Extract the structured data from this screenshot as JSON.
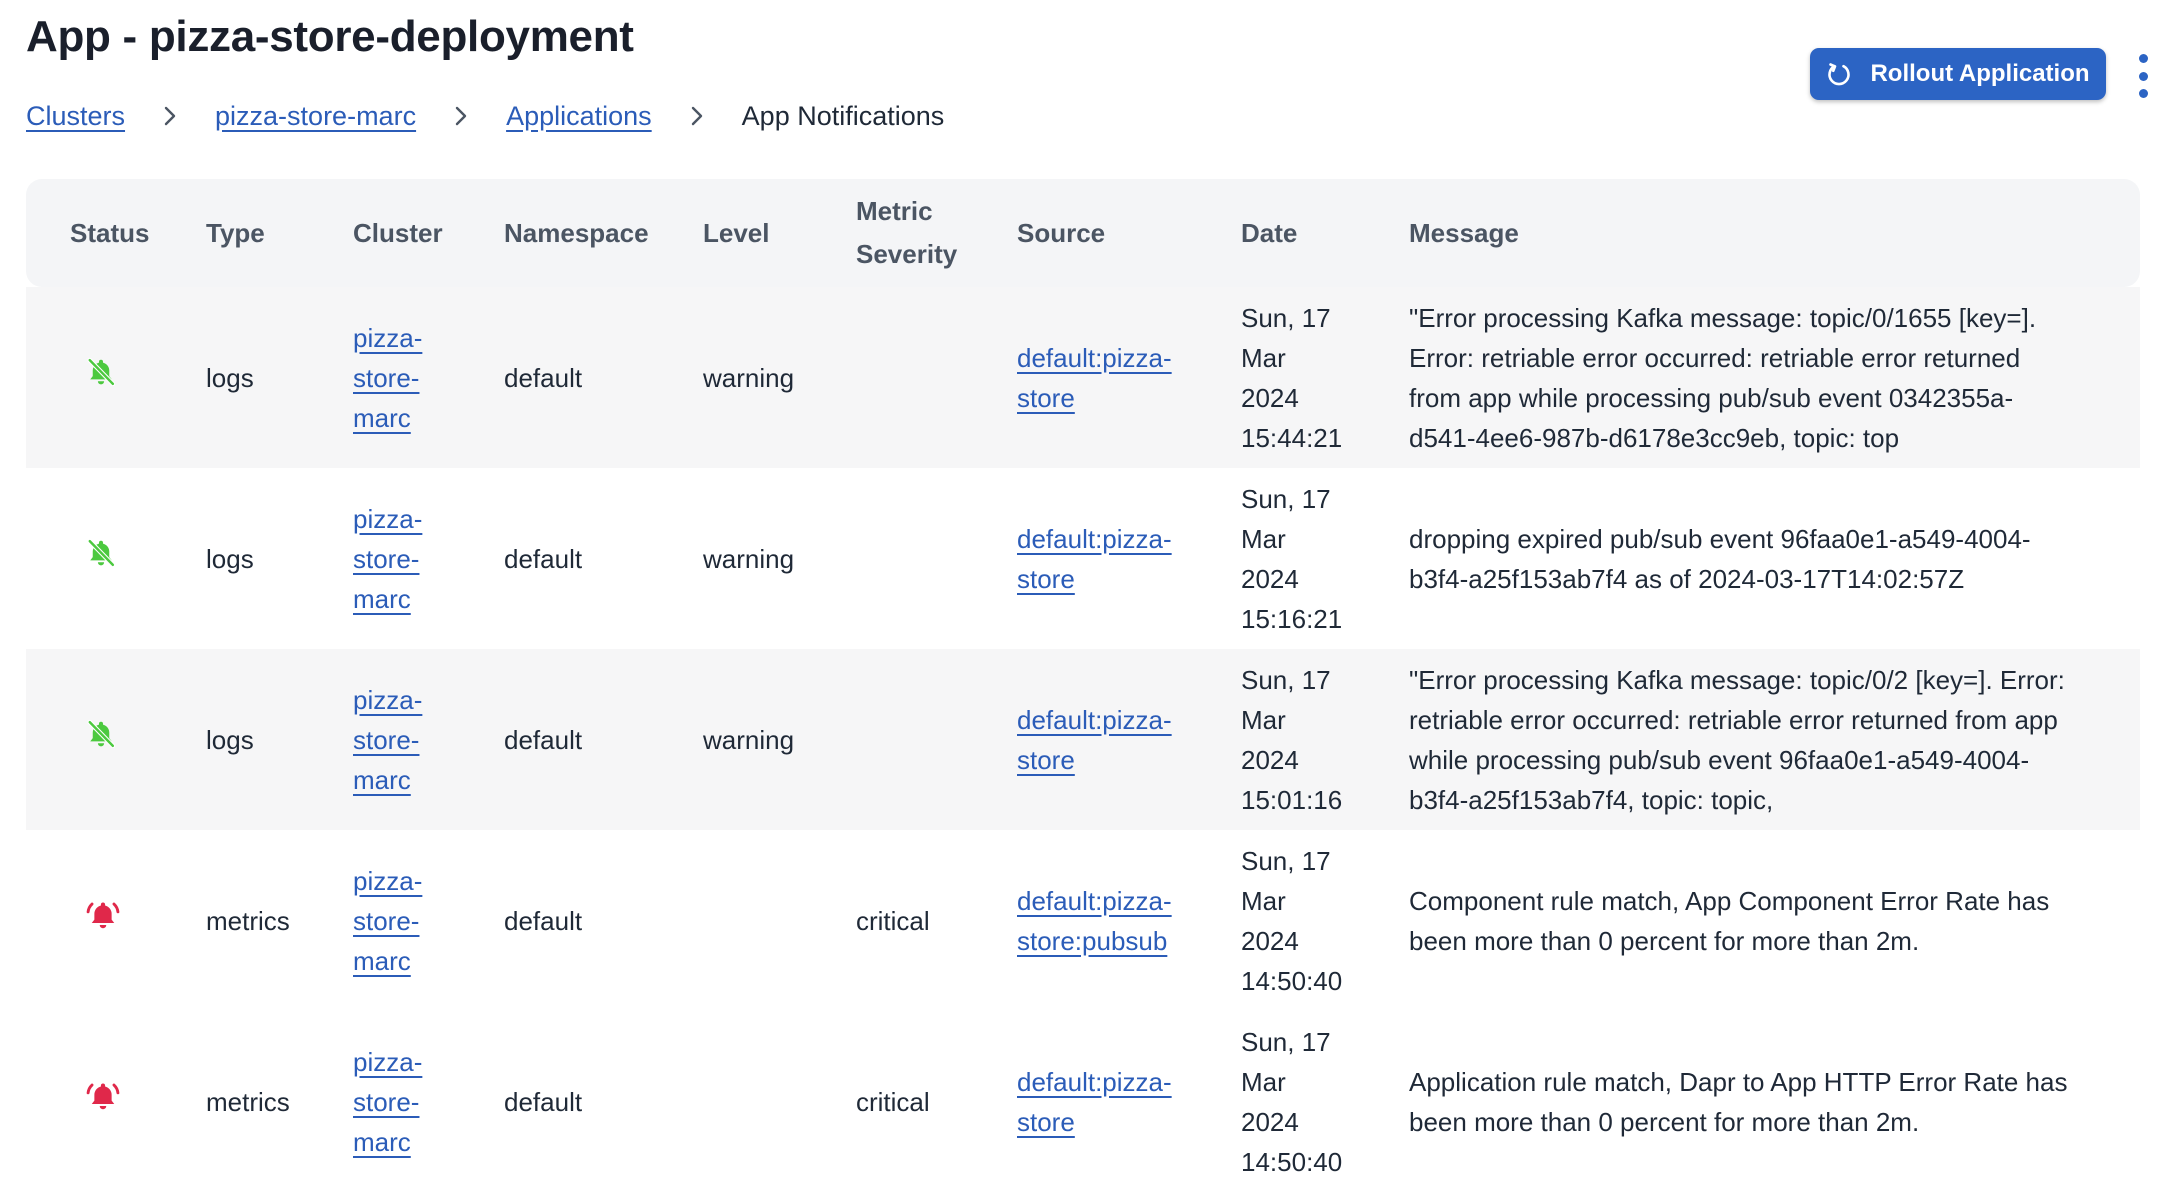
{
  "page": {
    "title": "App - pizza-store-deployment",
    "rollout_label": "Rollout Application"
  },
  "breadcrumb": {
    "items": [
      "Clusters",
      "pizza-store-marc",
      "Applications"
    ],
    "current": "App Notifications"
  },
  "table": {
    "headers": {
      "status": "Status",
      "type": "Type",
      "cluster": "Cluster",
      "namespace": "Namespace",
      "level": "Level",
      "metric_severity_1": "Metric",
      "metric_severity_2": "Severity",
      "source": "Source",
      "date": "Date",
      "message": "Message"
    },
    "rows": [
      {
        "status_icon": "bell-off-icon",
        "status_color": "#4cc93f",
        "type": "logs",
        "cluster": [
          "pizza-",
          "store-",
          "marc"
        ],
        "namespace": "default",
        "level": "warning",
        "metric_severity": "",
        "source": [
          "default:pizza-",
          "store"
        ],
        "date": [
          "Sun, 17",
          "Mar",
          "2024",
          "15:44:21"
        ],
        "message": [
          "\"Error processing Kafka message: topic/0/1655 [key=].",
          "Error: retriable error occurred: retriable error returned",
          "from app while processing pub/sub event 0342355a-",
          "d541-4ee6-987b-d6178e3cc9eb, topic: top"
        ]
      },
      {
        "status_icon": "bell-off-icon",
        "status_color": "#4cc93f",
        "type": "logs",
        "cluster": [
          "pizza-",
          "store-",
          "marc"
        ],
        "namespace": "default",
        "level": "warning",
        "metric_severity": "",
        "source": [
          "default:pizza-",
          "store"
        ],
        "date": [
          "Sun, 17",
          "Mar",
          "2024",
          "15:16:21"
        ],
        "message": [
          "dropping expired pub/sub event 96faa0e1-a549-4004-",
          "b3f4-a25f153ab7f4 as of 2024-03-17T14:02:57Z"
        ]
      },
      {
        "status_icon": "bell-off-icon",
        "status_color": "#4cc93f",
        "type": "logs",
        "cluster": [
          "pizza-",
          "store-",
          "marc"
        ],
        "namespace": "default",
        "level": "warning",
        "metric_severity": "",
        "source": [
          "default:pizza-",
          "store"
        ],
        "date": [
          "Sun, 17",
          "Mar",
          "2024",
          "15:01:16"
        ],
        "message": [
          "\"Error processing Kafka message: topic/0/2 [key=]. Error:",
          "retriable error occurred: retriable error returned from app",
          "while processing pub/sub event 96faa0e1-a549-4004-",
          "b3f4-a25f153ab7f4, topic: topic,"
        ]
      },
      {
        "status_icon": "bell-ringing-icon",
        "status_color": "#e0284a",
        "type": "metrics",
        "cluster": [
          "pizza-",
          "store-",
          "marc"
        ],
        "namespace": "default",
        "level": "",
        "metric_severity": "critical",
        "source": [
          "default:pizza-",
          "store:pubsub"
        ],
        "date": [
          "Sun, 17",
          "Mar",
          "2024",
          "14:50:40"
        ],
        "message": [
          "Component rule match, App Component Error Rate has",
          "been more than 0 percent for more than 2m."
        ]
      },
      {
        "status_icon": "bell-ringing-icon",
        "status_color": "#e0284a",
        "type": "metrics",
        "cluster": [
          "pizza-",
          "store-",
          "marc"
        ],
        "namespace": "default",
        "level": "",
        "metric_severity": "critical",
        "source": [
          "default:pizza-",
          "store"
        ],
        "date": [
          "Sun, 17",
          "Mar",
          "2024",
          "14:50:40"
        ],
        "message": [
          "Application rule match, Dapr to App HTTP Error Rate has",
          "been more than 0 percent for more than 2m."
        ]
      }
    ]
  },
  "colors": {
    "accent": "#2c64c4",
    "link": "#2b5cb8",
    "ok_green": "#4cc93f",
    "alert_red": "#e0284a"
  }
}
